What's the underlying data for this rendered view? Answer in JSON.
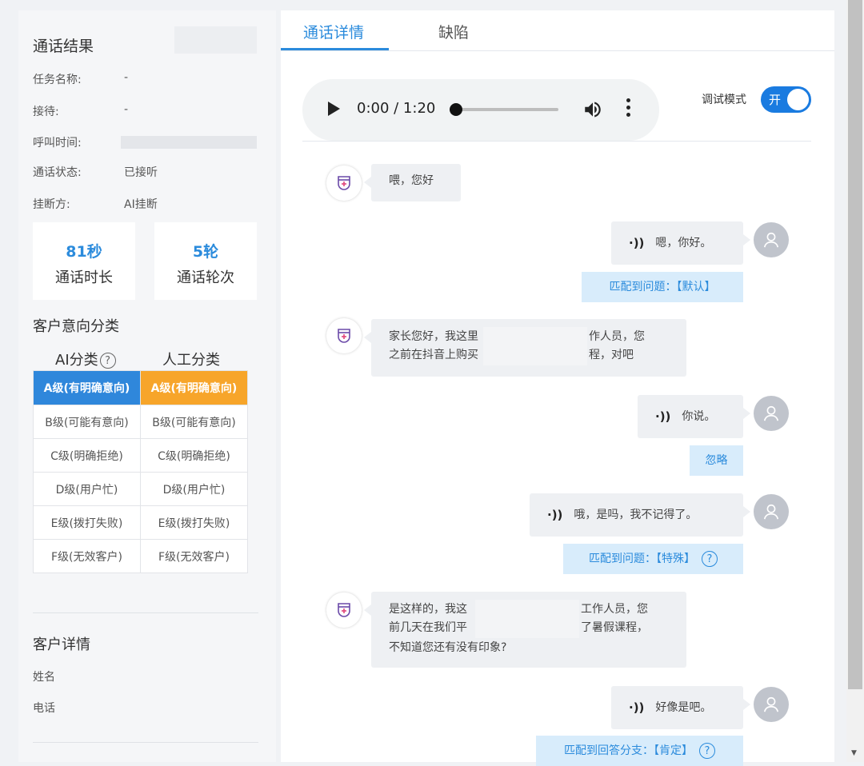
{
  "call_result": {
    "title": "通话结果",
    "fields": [
      {
        "label": "任务名称:",
        "value": "-"
      },
      {
        "label": "接待:",
        "value": "-"
      },
      {
        "label": "呼叫时间:",
        "value": ""
      },
      {
        "label": "通话状态:",
        "value": "已接听"
      },
      {
        "label": "挂断方:",
        "value": "AI挂断"
      }
    ]
  },
  "stats": [
    {
      "value": "81秒",
      "label": "通话时长"
    },
    {
      "value": "5轮",
      "label": "通话轮次"
    }
  ],
  "intent": {
    "title": "客户意向分类",
    "ai_header": "AI分类",
    "manual_header": "人工分类",
    "rows": [
      {
        "ai": "A级(有明确意向)",
        "manual": "A级(有明确意向)"
      },
      {
        "ai": "B级(可能有意向)",
        "manual": "B级(可能有意向)"
      },
      {
        "ai": "C级(明确拒绝)",
        "manual": "C级(明确拒绝)"
      },
      {
        "ai": "D级(用户忙)",
        "manual": "D级(用户忙)"
      },
      {
        "ai": "E级(拨打失败)",
        "manual": "E级(拨打失败)"
      },
      {
        "ai": "F级(无效客户)",
        "manual": "F级(无效客户)"
      }
    ]
  },
  "customer": {
    "title": "客户详情",
    "name_label": "姓名",
    "phone_label": "电话"
  },
  "tabs": [
    {
      "label": "通话详情",
      "active": true
    },
    {
      "label": "缺陷",
      "active": false
    }
  ],
  "player": {
    "time": "0:00 / 1:20",
    "progress": 0
  },
  "debug": {
    "label": "调试模式",
    "state": "开"
  },
  "messages": [
    {
      "role": "bot",
      "lines": [
        "喂，您好"
      ]
    },
    {
      "role": "user",
      "text": "嗯，你好。",
      "tag": "匹配到问题：【默认】",
      "help": false
    },
    {
      "role": "bot",
      "lines": [
        "家长您好，我这里",
        "作人员，您",
        "之前在抖音上购买",
        "程，对吧"
      ]
    },
    {
      "role": "user",
      "text": "你说。",
      "tag": "忽略",
      "help": false
    },
    {
      "role": "user",
      "text": "哦，是吗，我不记得了。",
      "tag": "匹配到问题：【特殊】",
      "help": true
    },
    {
      "role": "bot",
      "lines": [
        "是这样的，我这",
        "工作人员，您",
        "前几天在我们平",
        "了暑假课程，",
        "不知道您还有没有印象?"
      ]
    },
    {
      "role": "user",
      "text": "好像是吧。",
      "tag": "匹配到回答分支：【肯定】",
      "help": true
    }
  ],
  "icons": {
    "help": "question-circle-icon",
    "bot": "bot-avatar-icon",
    "user": "user-avatar-icon",
    "wave": "voice-wave-icon"
  },
  "colors": {
    "primary": "#2b8bdc",
    "a_manual": "#f7a52a",
    "a_ai": "#2f87db",
    "switch": "#1a7be0",
    "tag_bg": "#d8ecfb"
  }
}
